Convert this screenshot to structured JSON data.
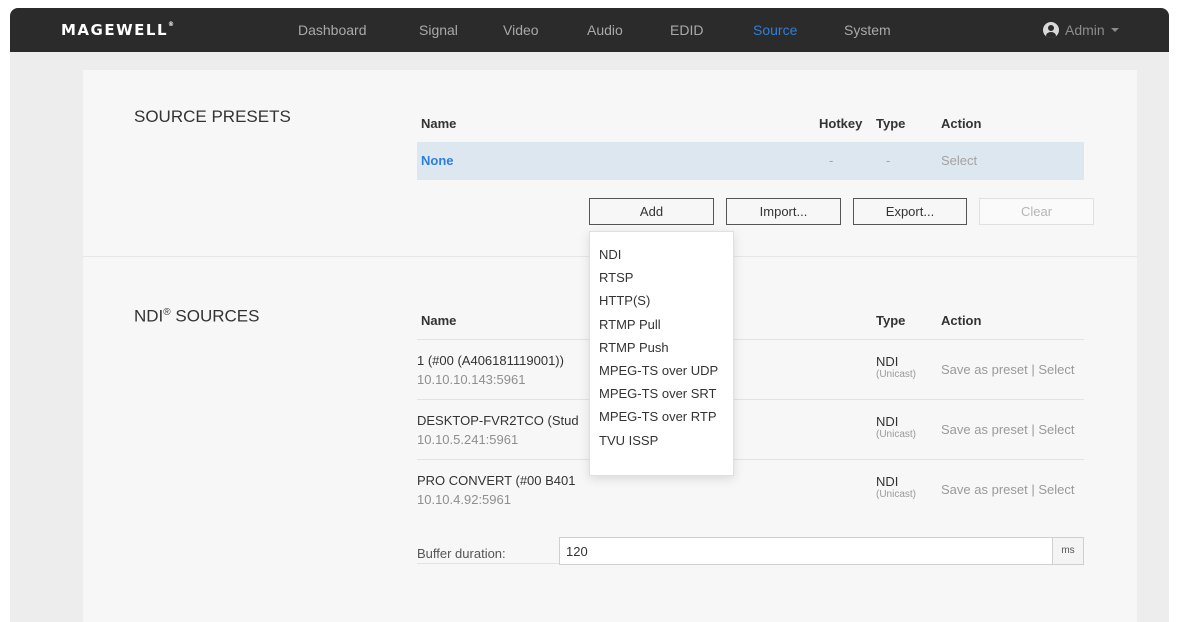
{
  "brand": {
    "logo": "MAGEWELL",
    "reg": "®"
  },
  "nav": {
    "items": [
      {
        "label": "Dashboard",
        "active": false
      },
      {
        "label": "Signal",
        "active": false
      },
      {
        "label": "Video",
        "active": false
      },
      {
        "label": "Audio",
        "active": false
      },
      {
        "label": "EDID",
        "active": false
      },
      {
        "label": "Source",
        "active": true
      },
      {
        "label": "System",
        "active": false
      }
    ],
    "user": {
      "label": "Admin",
      "icon": "user-icon"
    }
  },
  "presets": {
    "title": "SOURCE PRESETS",
    "columns": {
      "name": "Name",
      "hotkey": "Hotkey",
      "type": "Type",
      "action": "Action"
    },
    "rows": [
      {
        "name": "None",
        "hotkey": "-",
        "type": "-",
        "action": "Select"
      }
    ],
    "buttons": {
      "add": "Add",
      "import": "Import...",
      "export": "Export...",
      "clear": "Clear"
    }
  },
  "add_menu": {
    "items": [
      "NDI",
      "RTSP",
      "HTTP(S)",
      "RTMP Pull",
      "RTMP Push",
      "MPEG-TS over UDP",
      "MPEG-TS over SRT",
      "MPEG-TS over RTP",
      "TVU ISSP"
    ]
  },
  "ndi": {
    "title_pre": "NDI",
    "title_sup": "®",
    "title_post": " SOURCES",
    "columns": {
      "name": "Name",
      "type": "Type",
      "action": "Action"
    },
    "rows": [
      {
        "name": "1 (#00 (A406181119001))",
        "address": "10.10.10.143:5961",
        "type": "NDI",
        "mode": "(Unicast)",
        "save": "Save as preset",
        "sep": " | ",
        "select": "Select"
      },
      {
        "name": "DESKTOP-FVR2TCO (Stud",
        "address": "10.10.5.241:5961",
        "type": "NDI",
        "mode": "(Unicast)",
        "save": "Save as preset",
        "sep": " | ",
        "select": "Select"
      },
      {
        "name": "PRO CONVERT (#00 B401",
        "address": "10.10.4.92:5961",
        "type": "NDI",
        "mode": "(Unicast)",
        "save": "Save as preset",
        "sep": " | ",
        "select": "Select"
      }
    ],
    "buffer": {
      "label": "Buffer duration:",
      "value": "120",
      "unit": "ms"
    }
  },
  "colors": {
    "accent": "#2f7fd8",
    "nav_bg": "#2b2b2b",
    "selected_row": "#dde7ef"
  }
}
